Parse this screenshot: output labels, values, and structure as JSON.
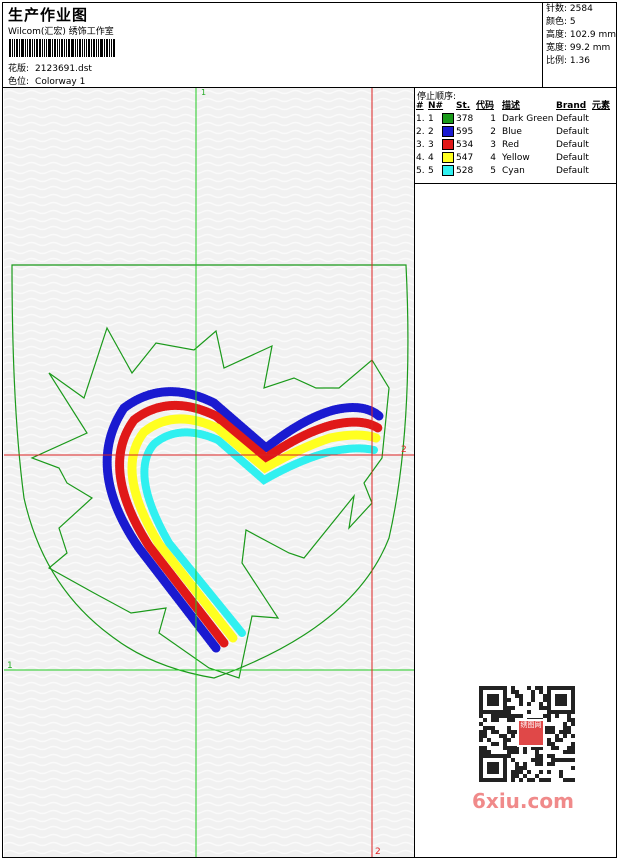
{
  "header": {
    "title": "生产作业图",
    "studio": "Wilcom(汇宏) 绣饰工作室",
    "design_label": "花版:",
    "design_value": "2123691.dst",
    "colorway_label": "色位:",
    "colorway_value": "Colorway 1"
  },
  "stats": {
    "stitches": "针数: 2584",
    "colors": "颜色: 5",
    "height": "高度: 102.9 mm",
    "width": "宽度: 99.2 mm",
    "ratio": "比例: 1.36"
  },
  "sequence": {
    "title": "停止顺序:",
    "columns": [
      "#",
      "N#",
      "St.",
      "代码",
      "描述",
      "Brand",
      "元素"
    ],
    "rows": [
      {
        "idx": "1.",
        "n": "1",
        "st": "378",
        "code": "1",
        "desc": "Dark Green",
        "brand": "Default",
        "color": "#1a9a1a"
      },
      {
        "idx": "2.",
        "n": "2",
        "st": "595",
        "code": "2",
        "desc": "Blue",
        "brand": "Default",
        "color": "#1a1ad0"
      },
      {
        "idx": "3.",
        "n": "3",
        "st": "534",
        "code": "3",
        "desc": "Red",
        "brand": "Default",
        "color": "#e01818"
      },
      {
        "idx": "4.",
        "n": "4",
        "st": "547",
        "code": "4",
        "desc": "Yellow",
        "brand": "Default",
        "color": "#ffff20"
      },
      {
        "idx": "5.",
        "n": "5",
        "st": "528",
        "code": "5",
        "desc": "Cyan",
        "brand": "Default",
        "color": "#30f0f0"
      }
    ]
  },
  "guides": {
    "top_marker": "1",
    "left_marker": "1",
    "right_marker": "2",
    "bottom_marker": "2"
  },
  "watermark": {
    "text": "6xiu.com",
    "stamp": "绣图网"
  }
}
